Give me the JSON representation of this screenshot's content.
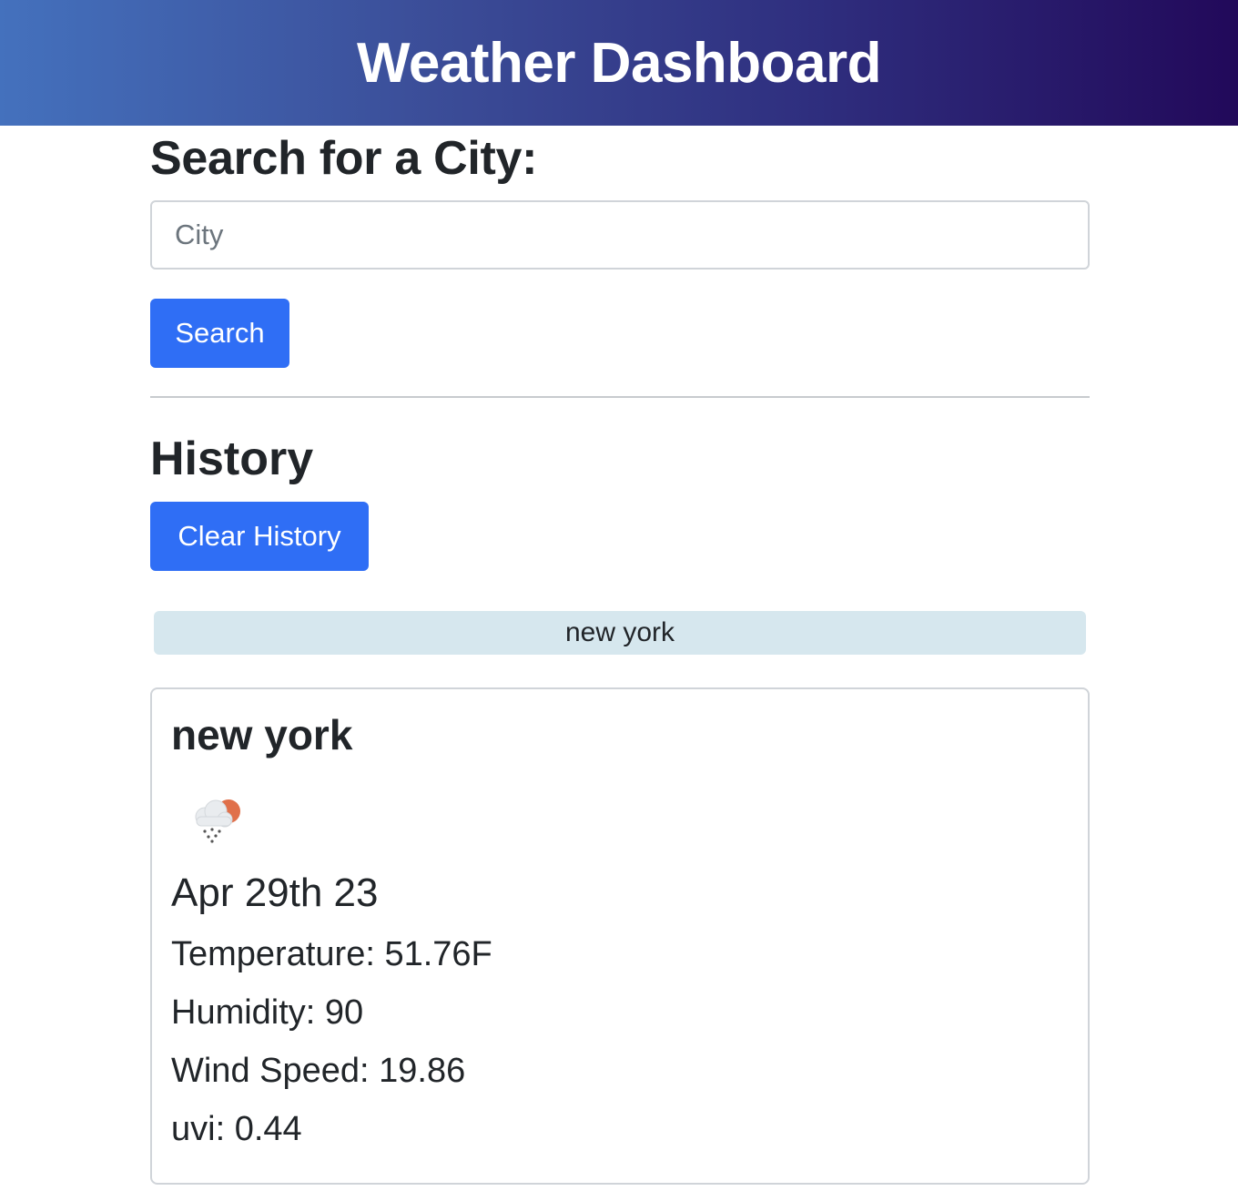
{
  "header": {
    "title": "Weather Dashboard"
  },
  "search": {
    "heading": "Search for a City:",
    "placeholder": "City",
    "value": "",
    "button_label": "Search"
  },
  "history": {
    "heading": "History",
    "clear_label": "Clear History",
    "items": [
      "new york"
    ]
  },
  "current": {
    "city": "new york",
    "icon": "rain-snow-partly-cloudy-icon",
    "date": "Apr 29th 23",
    "temperature": "Temperature: 51.76F",
    "humidity": "Humidity: 90",
    "wind": "Wind Speed: 19.86",
    "uvi": "uvi: 0.44"
  },
  "colors": {
    "header_gradient_start": "#4471bd",
    "header_gradient_end": "#22095a",
    "primary_button": "#2f6ef5",
    "history_item_bg": "#d6e7ee"
  }
}
